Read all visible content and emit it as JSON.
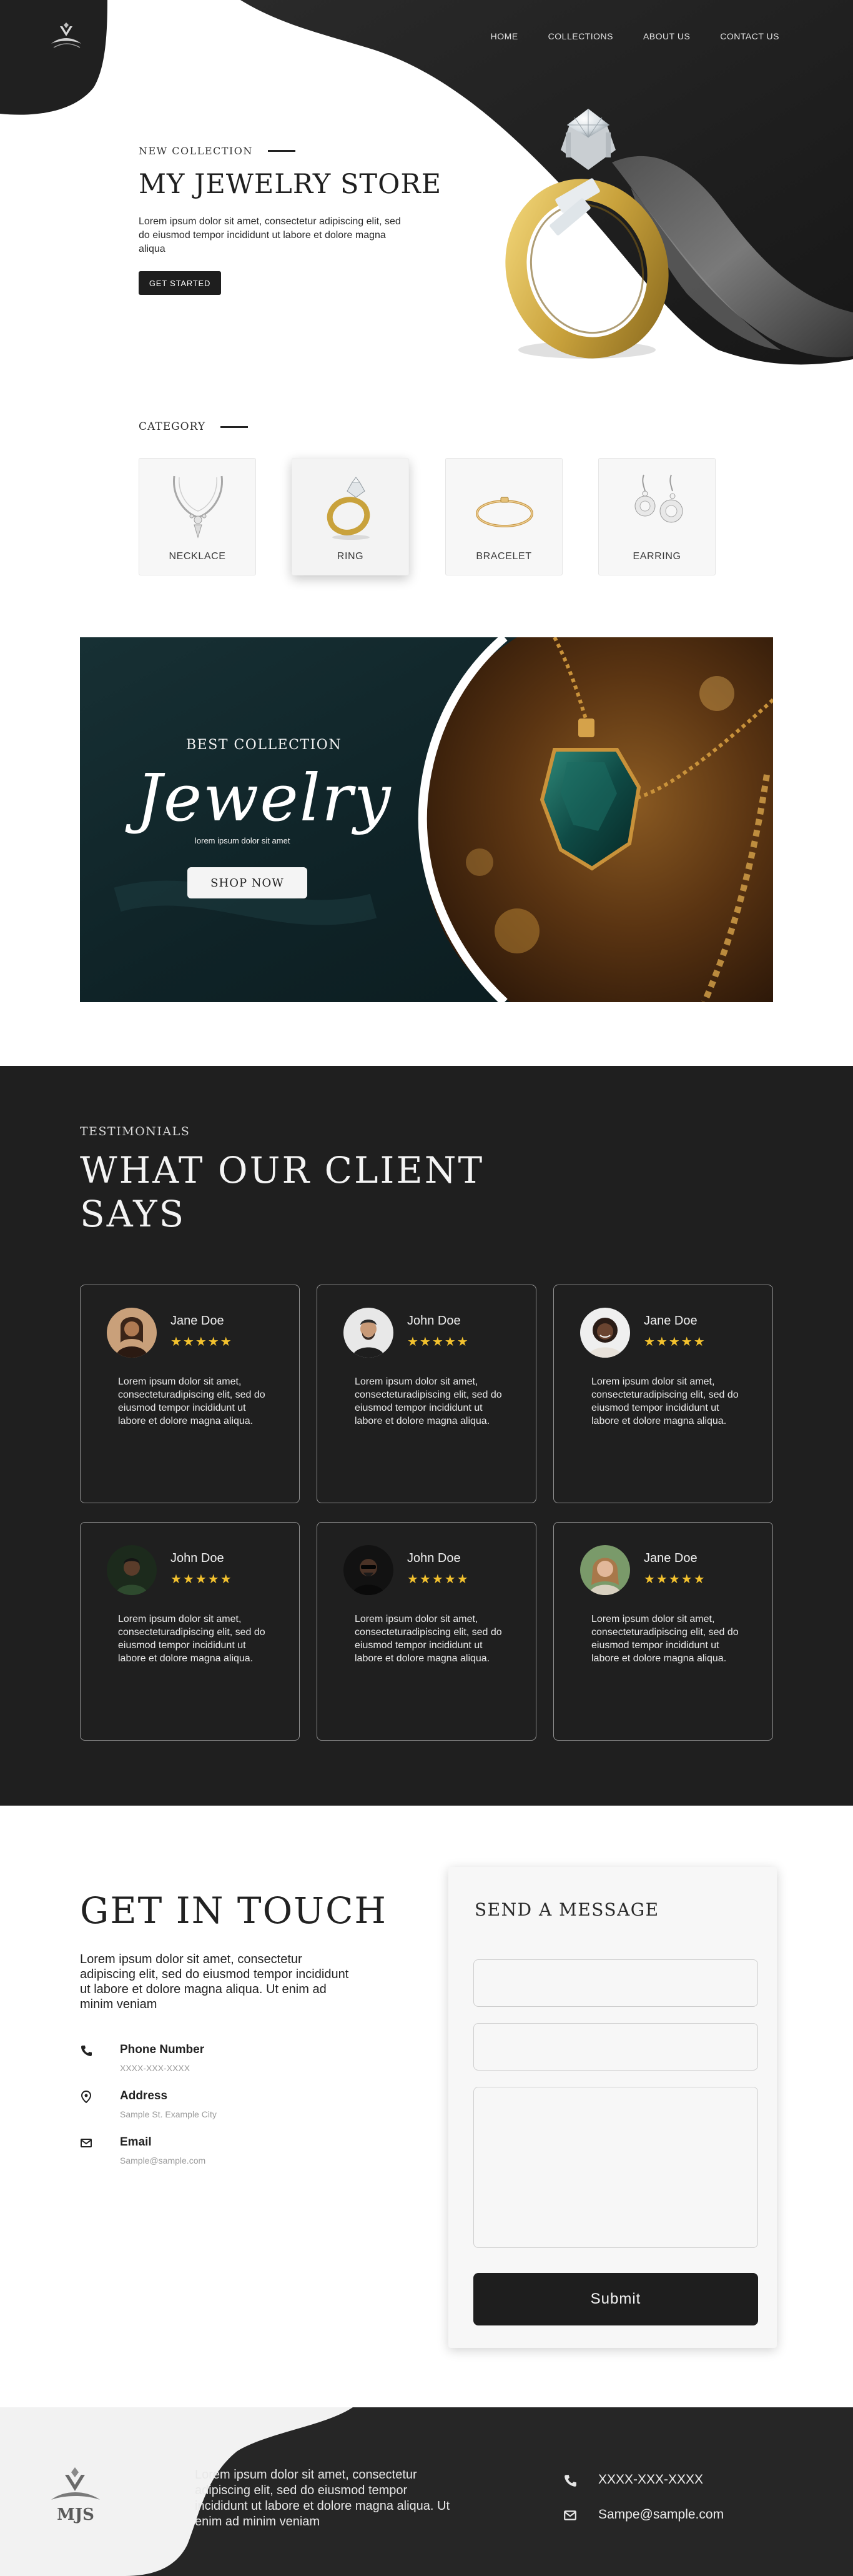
{
  "nav": {
    "items": [
      {
        "label": "HOME"
      },
      {
        "label": "COLLECTIONS"
      },
      {
        "label": "ABOUT US"
      },
      {
        "label": "CONTACT US"
      }
    ]
  },
  "hero": {
    "eyebrow": "NEW COLLECTION",
    "title": "MY JEWELRY STORE",
    "description": "Lorem ipsum dolor sit amet, consectetur adipiscing elit, sed do eiusmod tempor incididunt ut labore et dolore magna aliqua",
    "cta_label": "GET STARTED"
  },
  "category": {
    "eyebrow": "CATEGORY",
    "items": [
      {
        "label": "NECKLACE",
        "icon": "necklace-icon"
      },
      {
        "label": "RING",
        "icon": "ring-icon"
      },
      {
        "label": "BRACELET",
        "icon": "bracelet-icon"
      },
      {
        "label": "EARRING",
        "icon": "earring-icon"
      }
    ]
  },
  "banner": {
    "eyebrow": "BEST COLLECTION",
    "script_title": "Jewelry",
    "subtitle": "lorem ipsum dolor sit amet",
    "cta_label": "SHOP NOW"
  },
  "testimonials": {
    "eyebrow": "TESTIMONIALS",
    "title": "WHAT OUR CLIENT SAYS",
    "stars_glyph": "★★★★★",
    "cards": [
      {
        "name": "Jane Doe",
        "rating": 5,
        "text": "Lorem ipsum dolor sit amet, consecteturadipiscing elit, sed do eiusmod tempor incididunt ut labore et dolore magna aliqua."
      },
      {
        "name": "John Doe",
        "rating": 5,
        "text": "Lorem ipsum dolor sit amet, consecteturadipiscing elit, sed do eiusmod tempor incididunt ut labore et dolore magna aliqua."
      },
      {
        "name": "Jane Doe",
        "rating": 5,
        "text": "Lorem ipsum dolor sit amet, consecteturadipiscing elit, sed do eiusmod tempor incididunt ut labore et dolore magna aliqua."
      },
      {
        "name": "John Doe",
        "rating": 5,
        "text": "Lorem ipsum dolor sit amet, consecteturadipiscing elit, sed do eiusmod tempor incididunt ut labore et dolore magna aliqua."
      },
      {
        "name": "John Doe",
        "rating": 5,
        "text": "Lorem ipsum dolor sit amet, consecteturadipiscing elit, sed do eiusmod tempor incididunt ut labore et dolore magna aliqua."
      },
      {
        "name": "Jane Doe",
        "rating": 5,
        "text": "Lorem ipsum dolor sit amet, consecteturadipiscing elit, sed do eiusmod tempor incididunt ut labore et dolore magna aliqua."
      }
    ]
  },
  "contact": {
    "title": "GET IN TOUCH",
    "description": "Lorem ipsum dolor sit amet, consectetur adipiscing elit, sed do eiusmod tempor incididunt ut labore et dolore magna aliqua. Ut enim ad minim veniam",
    "phone": {
      "label": "Phone Number",
      "value": "XXXX-XXX-XXXX"
    },
    "address": {
      "label": "Address",
      "value": "Sample St. Example City"
    },
    "email": {
      "label": "Email",
      "value": "Sample@sample.com"
    }
  },
  "form": {
    "title": "SEND A MESSAGE",
    "submit_label": "Submit"
  },
  "footer": {
    "logo_text": "MJS",
    "description": "Lorem ipsum dolor sit amet, consectetur adipiscing elit, sed do eiusmod tempor incididunt ut labore et dolore magna aliqua. Ut enim ad minim veniam",
    "phone": "XXXX-XXX-XXXX",
    "email": "Sampe@sample.com"
  },
  "colors": {
    "dark": "#1f1f1f",
    "light": "#ffffff",
    "star": "#f2c12e",
    "gold": "#c9a23c"
  }
}
